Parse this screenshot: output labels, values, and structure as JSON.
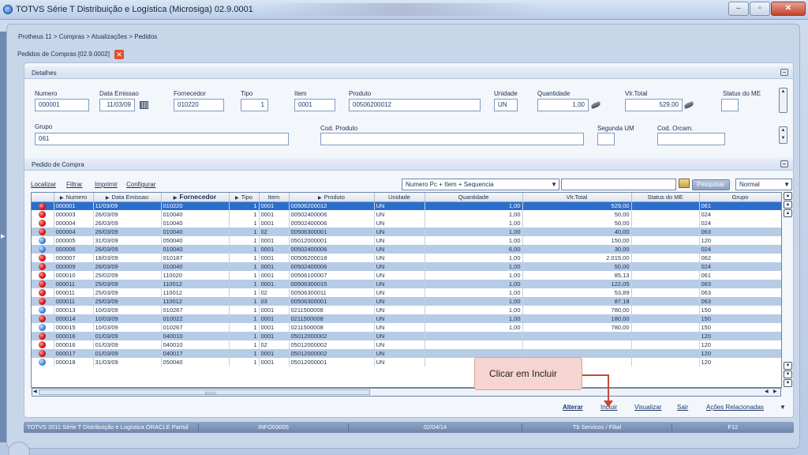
{
  "window": {
    "title": "TOTVS Série T Distribuição e Logística (Microsiga) 02.9.0001",
    "min": "–",
    "max": "▫",
    "close": "✕"
  },
  "breadcrumb": "Protheus 11 > Compras  > Atualizações > Pedidos",
  "form_tab": {
    "label": "Pedidos de Compras [02.9.0002]",
    "close": "✕"
  },
  "detalhes": {
    "title": "Detalhes",
    "fields": {
      "numero": {
        "label": "Numero",
        "value": "000001"
      },
      "data_emissao": {
        "label": "Data Emissao",
        "value": "11/03/09"
      },
      "fornecedor": {
        "label": "Fornecedor",
        "value": "010220"
      },
      "tipo": {
        "label": "Tipo",
        "value": "1"
      },
      "item": {
        "label": "Item",
        "value": "0001"
      },
      "produto": {
        "label": "Produto",
        "value": "00506200012"
      },
      "unidade": {
        "label": "Unidade",
        "value": "UN"
      },
      "quantidade": {
        "label": "Quantidade",
        "value": "1,00"
      },
      "vlr_total": {
        "label": "Vlr.Total",
        "value": "529,00"
      },
      "status_me": {
        "label": "Status do ME",
        "value": ""
      },
      "grupo": {
        "label": "Grupo",
        "value": "061"
      },
      "cod_produto": {
        "label": "Cod. Produto",
        "value": ""
      },
      "segunda_um": {
        "label": "Segunda UM",
        "value": ""
      },
      "cod_orcam": {
        "label": "Cod. Orcam.",
        "value": ""
      }
    }
  },
  "pedido": {
    "title": "Pedido de Compra",
    "toolbar": {
      "localizar": "Localizar",
      "filtrar": "Filtrar",
      "imprimir": "Imprimir",
      "configurar": "Configurar"
    },
    "index_select": "Numero Pc + Item + Sequencia",
    "search_value": "",
    "search_button": "Pesquisar",
    "mode_select": "Normal",
    "columns": [
      "",
      "Numero",
      "Data Emissao",
      "Fornecedor",
      "Tipo",
      "Item",
      "Produto",
      "Unidade",
      "Quantidade",
      "Vlr.Total",
      "Status do ME",
      "Grupo"
    ],
    "rows": [
      {
        "status": "red",
        "numero": "000001",
        "data": "11/03/09",
        "fornecedor": "010220",
        "tipo": "1",
        "item": "0001",
        "produto": "00506200012",
        "unidade": "UN",
        "quantidade": "1,00",
        "total": "529,00",
        "grupo": "061",
        "style": "sel"
      },
      {
        "status": "red",
        "numero": "000003",
        "data": "26/03/09",
        "fornecedor": "010040",
        "tipo": "1",
        "item": "0001",
        "produto": "00502400006",
        "unidade": "UN",
        "quantidade": "1,00",
        "total": "50,00",
        "grupo": "024",
        "style": "white"
      },
      {
        "status": "red",
        "numero": "000004",
        "data": "26/03/09",
        "fornecedor": "010040",
        "tipo": "1",
        "item": "0001",
        "produto": "00502400006",
        "unidade": "UN",
        "quantidade": "1,00",
        "total": "50,00",
        "grupo": "024",
        "style": "white"
      },
      {
        "status": "red",
        "numero": "000004",
        "data": "26/03/09",
        "fornecedor": "010040",
        "tipo": "1",
        "item": "02",
        "produto": "00506300001",
        "unidade": "UN",
        "quantidade": "1,00",
        "total": "40,00",
        "grupo": "063",
        "style": "blue"
      },
      {
        "status": "blue",
        "numero": "000005",
        "data": "31/03/09",
        "fornecedor": "050040",
        "tipo": "1",
        "item": "0001",
        "produto": "05012000001",
        "unidade": "UN",
        "quantidade": "1,00",
        "total": "150,00",
        "grupo": "120",
        "style": "white"
      },
      {
        "status": "blue",
        "numero": "000006",
        "data": "26/03/09",
        "fornecedor": "010040",
        "tipo": "1",
        "item": "0001",
        "produto": "00502400006",
        "unidade": "UN",
        "quantidade": "6,00",
        "total": "30,00",
        "grupo": "024",
        "style": "blue"
      },
      {
        "status": "red",
        "numero": "000007",
        "data": "18/03/09",
        "fornecedor": "010187",
        "tipo": "1",
        "item": "0001",
        "produto": "00506200018",
        "unidade": "UN",
        "quantidade": "1,00",
        "total": "2.015,00",
        "grupo": "062",
        "style": "white"
      },
      {
        "status": "red",
        "numero": "000009",
        "data": "26/03/09",
        "fornecedor": "010040",
        "tipo": "1",
        "item": "0001",
        "produto": "00502400006",
        "unidade": "UN",
        "quantidade": "1,00",
        "total": "50,00",
        "grupo": "024",
        "style": "blue"
      },
      {
        "status": "red",
        "numero": "000010",
        "data": "25/02/09",
        "fornecedor": "110020",
        "tipo": "1",
        "item": "0001",
        "produto": "00506100007",
        "unidade": "UN",
        "quantidade": "1,00",
        "total": "85,13",
        "grupo": "061",
        "style": "white"
      },
      {
        "status": "red",
        "numero": "000011",
        "data": "25/03/09",
        "fornecedor": "110012",
        "tipo": "1",
        "item": "0001",
        "produto": "00506300015",
        "unidade": "UN",
        "quantidade": "1,00",
        "total": "122,05",
        "grupo": "063",
        "style": "blue"
      },
      {
        "status": "red",
        "numero": "000011",
        "data": "25/03/09",
        "fornecedor": "110012",
        "tipo": "1",
        "item": "02",
        "produto": "00506300011",
        "unidade": "UN",
        "quantidade": "1,00",
        "total": "53,89",
        "grupo": "063",
        "style": "white"
      },
      {
        "status": "red",
        "numero": "000011",
        "data": "25/03/09",
        "fornecedor": "110012",
        "tipo": "1",
        "item": "03",
        "produto": "00506300001",
        "unidade": "UN",
        "quantidade": "1,00",
        "total": "87,18",
        "grupo": "063",
        "style": "blue"
      },
      {
        "status": "blue",
        "numero": "000013",
        "data": "10/03/09",
        "fornecedor": "010267",
        "tipo": "1",
        "item": "0001",
        "produto": "0211500008",
        "unidade": "UN",
        "quantidade": "1,00",
        "total": "780,00",
        "grupo": "150",
        "style": "white"
      },
      {
        "status": "red",
        "numero": "000014",
        "data": "10/03/09",
        "fornecedor": "010022",
        "tipo": "1",
        "item": "0001",
        "produto": "0211500008",
        "unidade": "UN",
        "quantidade": "1,00",
        "total": "180,00",
        "grupo": "150",
        "style": "blue"
      },
      {
        "status": "blue",
        "numero": "000015",
        "data": "10/03/09",
        "fornecedor": "010267",
        "tipo": "1",
        "item": "0001",
        "produto": "0211500008",
        "unidade": "UN",
        "quantidade": "1,00",
        "total": "780,00",
        "grupo": "150",
        "style": "white"
      },
      {
        "status": "red",
        "numero": "000016",
        "data": "01/03/09",
        "fornecedor": "040010",
        "tipo": "1",
        "item": "0001",
        "produto": "05012000002",
        "unidade": "UN",
        "quantidade": "",
        "total": "",
        "grupo": "120",
        "style": "blue"
      },
      {
        "status": "red",
        "numero": "000016",
        "data": "01/03/09",
        "fornecedor": "040010",
        "tipo": "1",
        "item": "02",
        "produto": "05012000002",
        "unidade": "UN",
        "quantidade": "",
        "total": "",
        "grupo": "120",
        "style": "white"
      },
      {
        "status": "red",
        "numero": "000017",
        "data": "01/03/09",
        "fornecedor": "040017",
        "tipo": "1",
        "item": "0001",
        "produto": "05012000002",
        "unidade": "UN",
        "quantidade": "",
        "total": "",
        "grupo": "120",
        "style": "blue"
      },
      {
        "status": "blue",
        "numero": "000018",
        "data": "31/03/09",
        "fornecedor": "050040",
        "tipo": "1",
        "item": "0001",
        "produto": "05012000001",
        "unidade": "UN",
        "quantidade": "",
        "total": "",
        "grupo": "120",
        "style": "white"
      }
    ],
    "actions": {
      "alterar": "Alterar",
      "incluir": "Incluir",
      "visualizar": "Visualizar",
      "sair": "Sair",
      "acoes": "Ações Relacionadas"
    }
  },
  "callout": {
    "text": "Clicar em Incluir"
  },
  "statusbar": [
    "TOTVS 2011 Série T Distribuição e Logística ORACLE Partsil",
    "INFO03005",
    "02/04/14",
    "Tb Servicos / Filial",
    "F12"
  ],
  "colors": {
    "selected_row": "#2b6ecc",
    "alt_row": "#b6cbe6",
    "status_red": "#d01010",
    "status_blue": "#3d7fd6",
    "callout_bg": "#f6d5d0"
  }
}
